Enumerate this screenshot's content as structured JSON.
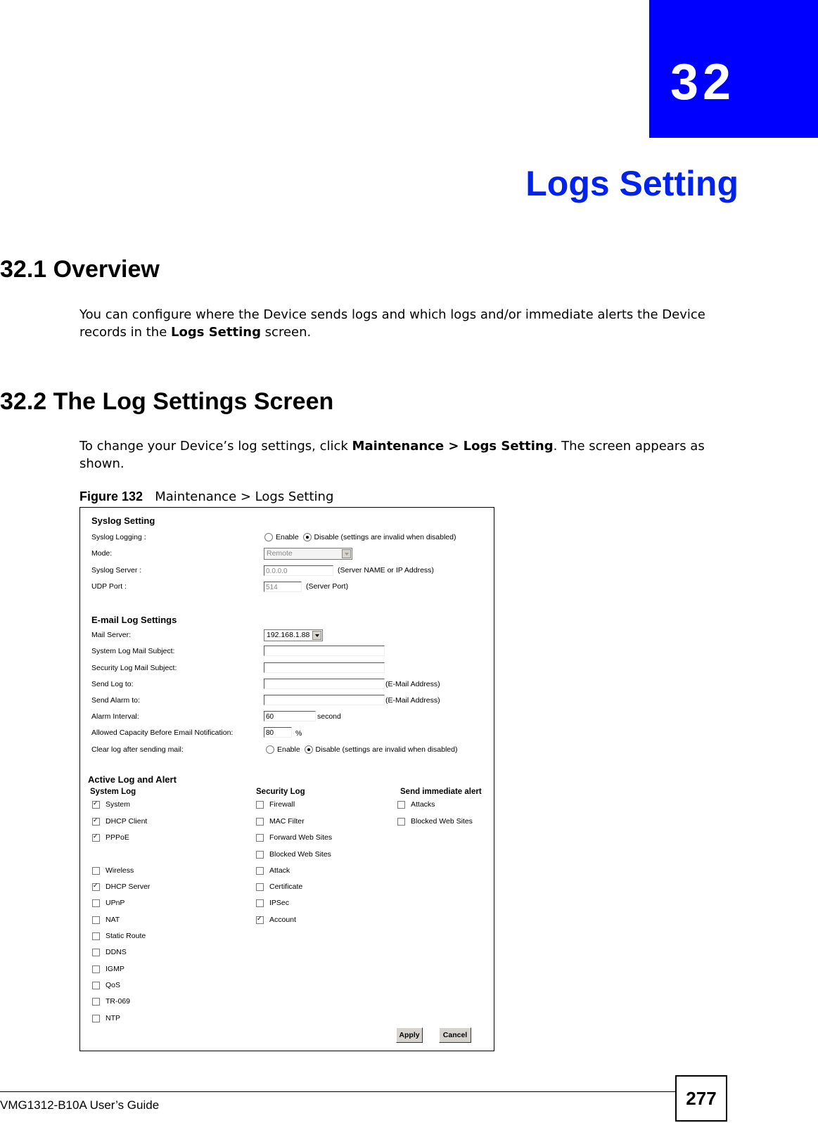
{
  "chapter": {
    "number": "32",
    "title": "Logs Setting"
  },
  "sections": [
    {
      "heading": "32.1  Overview",
      "body": [
        {
          "t": "You can configure where the Device sends logs and which logs and/or immediate alerts the Device records in the "
        },
        {
          "t": "Logs Setting",
          "b": true
        },
        {
          "t": " screen."
        }
      ]
    },
    {
      "heading": "32.2  The Log Settings Screen",
      "body": [
        {
          "t": "To change your Device’s log settings, click "
        },
        {
          "t": "Maintenance > Logs Setting",
          "b": true
        },
        {
          "t": ". The screen appears as shown."
        }
      ]
    }
  ],
  "figure": {
    "label": "Figure 132",
    "caption": "Maintenance > Logs Setting",
    "syslog": {
      "title": "Syslog Setting",
      "logging_label": "Syslog Logging :",
      "enable_label": "Enable",
      "disable_label": "Disable (settings are invalid when disabled)",
      "logging_value": "disable",
      "mode_label": "Mode:",
      "mode_value": "Remote",
      "server_label": "Syslog Server :",
      "server_value": "0.0.0.0",
      "server_hint": "(Server NAME or IP Address)",
      "port_label": "UDP Port :",
      "port_value": "514",
      "port_hint": "(Server Port)"
    },
    "email": {
      "title": "E-mail Log Settings",
      "mail_server_label": "Mail Server:",
      "mail_server_value": "192.168.1.88",
      "sys_subject_label": "System Log Mail Subject:",
      "sys_subject_value": "",
      "sec_subject_label": "Security Log Mail Subject:",
      "sec_subject_value": "",
      "send_log_label": "Send Log to:",
      "send_log_value": "",
      "send_log_hint": "(E-Mail Address)",
      "send_alarm_label": "Send Alarm to:",
      "send_alarm_value": "",
      "send_alarm_hint": "(E-Mail Address)",
      "alarm_interval_label": "Alarm Interval:",
      "alarm_interval_value": "60",
      "alarm_interval_unit": "second",
      "capacity_label": "Allowed Capacity Before Email Notification:",
      "capacity_value": "80",
      "capacity_unit": "%",
      "clear_label": "Clear log after sending mail:",
      "clear_enable_label": "Enable",
      "clear_disable_label": "Disable (settings are invalid when disabled)",
      "clear_value": "disable"
    },
    "active": {
      "title": "Active Log and Alert",
      "system_log_title": "System Log",
      "security_log_title": "Security Log",
      "alert_title": "Send immediate alert",
      "system_log": [
        {
          "label": "System",
          "checked": true
        },
        {
          "label": "DHCP Client",
          "checked": true
        },
        {
          "label": "PPPoE",
          "checked": true
        },
        {
          "label": "Wireless",
          "checked": false
        },
        {
          "label": "DHCP Server",
          "checked": true
        },
        {
          "label": "UPnP",
          "checked": false
        },
        {
          "label": "NAT",
          "checked": false
        },
        {
          "label": "Static Route",
          "checked": false
        },
        {
          "label": "DDNS",
          "checked": false
        },
        {
          "label": "IGMP",
          "checked": false
        },
        {
          "label": "QoS",
          "checked": false
        },
        {
          "label": "TR-069",
          "checked": false
        },
        {
          "label": "NTP",
          "checked": false
        }
      ],
      "security_log": [
        {
          "label": "Firewall",
          "checked": false
        },
        {
          "label": "MAC Filter",
          "checked": false
        },
        {
          "label": "Forward Web Sites",
          "checked": false
        },
        {
          "label": "Blocked Web Sites",
          "checked": false
        },
        {
          "label": "Attack",
          "checked": false
        },
        {
          "label": "Certificate",
          "checked": false
        },
        {
          "label": "IPSec",
          "checked": false
        },
        {
          "label": "Account",
          "checked": true
        }
      ],
      "alerts": [
        {
          "label": "Attacks",
          "checked": false
        },
        {
          "label": "Blocked Web Sites",
          "checked": false
        }
      ]
    },
    "buttons": {
      "apply": "Apply",
      "cancel": "Cancel"
    }
  },
  "footer": {
    "guide_title": "VMG1312-B10A User’s Guide",
    "page_number": "277"
  }
}
